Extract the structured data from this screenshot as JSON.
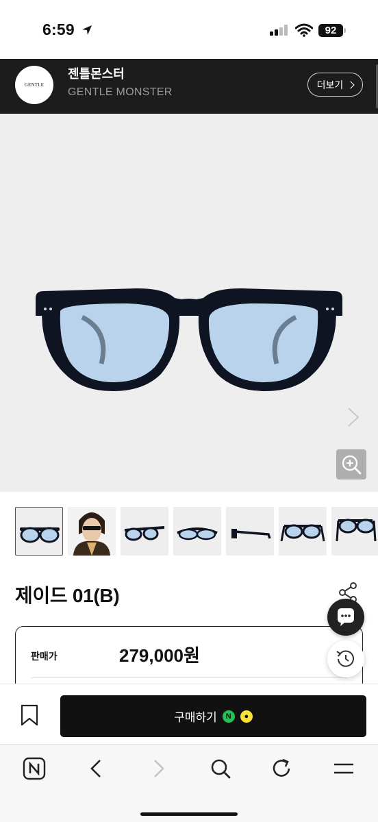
{
  "status_bar": {
    "time": "6:59",
    "battery": "92"
  },
  "store": {
    "name": "젠틀몬스터",
    "sub_name": "GENTLE MONSTER",
    "logo_text": "GENTLE MONSTER",
    "more_label": "더보기"
  },
  "product": {
    "title": "제이드 01(B)",
    "price_label": "판매가",
    "price_value": "279,000원",
    "thumbnails": [
      "thumb-front",
      "thumb-model",
      "thumb-angle",
      "thumb-top",
      "thumb-side",
      "thumb-open",
      "thumb-back"
    ]
  },
  "buy_bar": {
    "buy_label": "구매하기",
    "naver_pay": "N",
    "kakao_pay": "●"
  },
  "colors": {
    "lens": "#b9d3ec",
    "frame": "#0e1421",
    "header_bg": "#1c1c1c",
    "button_bg": "#111111"
  }
}
